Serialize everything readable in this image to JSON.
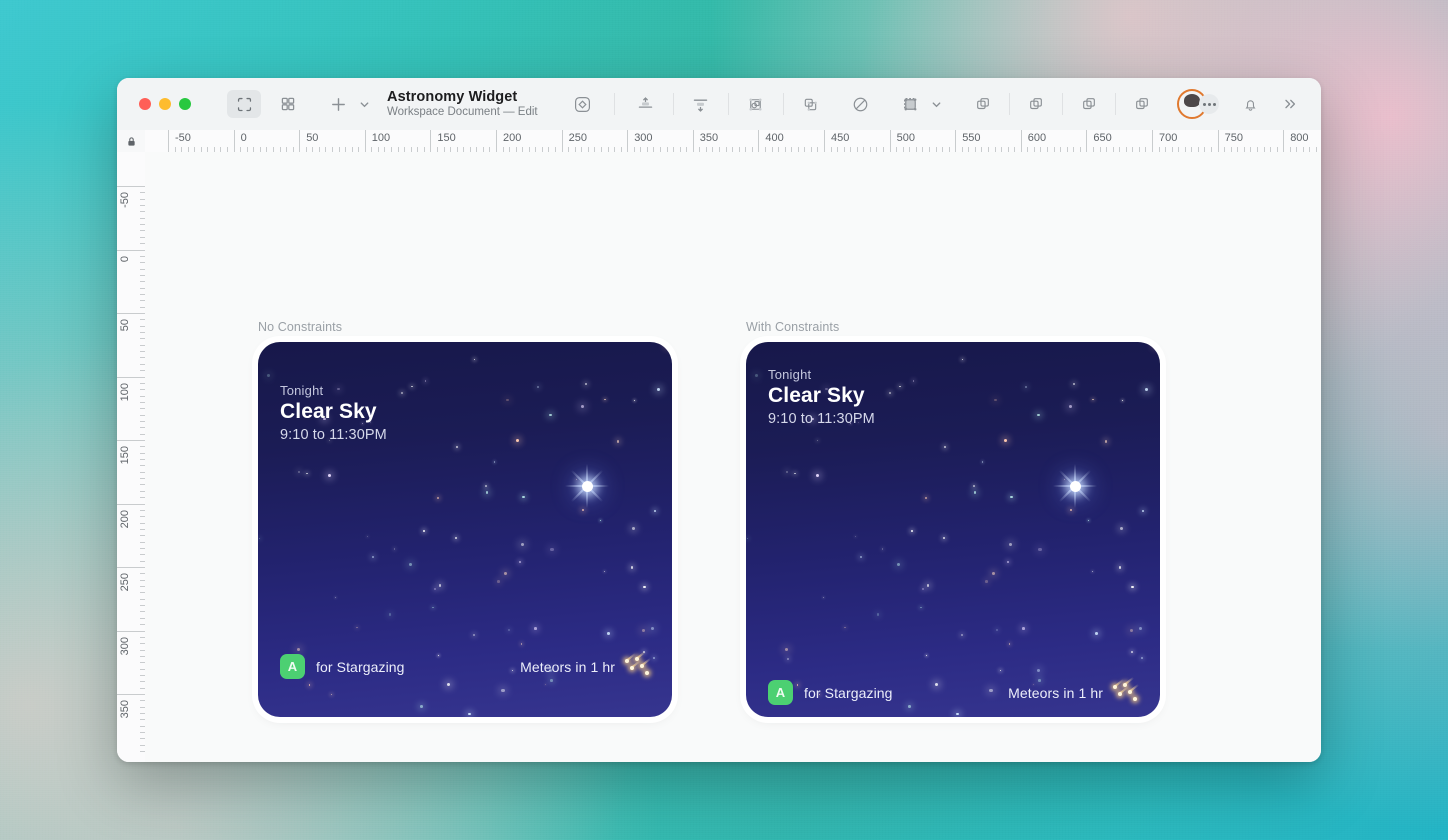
{
  "window": {
    "title": "Astronomy Widget",
    "subtitle": "Workspace Document — Edit",
    "traffic_lights": [
      "close",
      "minimize",
      "zoom"
    ]
  },
  "toolbar": {
    "left_tools": [
      {
        "name": "artboard-tool",
        "label": "Artboard",
        "active": true
      },
      {
        "name": "grid-tool",
        "label": "Grid View",
        "active": false
      },
      {
        "name": "insert-tool",
        "label": "Insert",
        "active": false
      },
      {
        "name": "insert-chevron",
        "label": "Insert menu",
        "active": false
      }
    ],
    "center_tools": [
      {
        "name": "shape-tool",
        "label": "Shape"
      },
      {
        "name": "align-top-tool",
        "label": "Align Top"
      },
      {
        "name": "distribute-tool",
        "label": "Distribute"
      },
      {
        "name": "mask-tool",
        "label": "Mask"
      },
      {
        "name": "boolean-tool",
        "label": "Boolean"
      },
      {
        "name": "style-tool",
        "label": "Style"
      },
      {
        "name": "constraints-tool",
        "label": "Constraints"
      },
      {
        "name": "constraints-chevron",
        "label": "Constraints menu"
      }
    ],
    "right_tools": [
      {
        "name": "union-tool",
        "label": "Union"
      },
      {
        "name": "subtract-tool",
        "label": "Subtract"
      },
      {
        "name": "intersect-tool",
        "label": "Intersect"
      },
      {
        "name": "difference-tool",
        "label": "Difference"
      }
    ],
    "account": {
      "name": "user-avatar",
      "label": "Account"
    },
    "more_label": "More",
    "notifications_label": "Notifications",
    "overflow_label": "More toolbar items"
  },
  "rulers": {
    "lock_icon": "lock-icon",
    "horizontal_ticks": [
      "-50",
      "0",
      "50",
      "100",
      "150",
      "200",
      "250",
      "300",
      "350",
      "400",
      "450",
      "500",
      "550",
      "600",
      "650",
      "700",
      "750",
      "800"
    ],
    "vertical_ticks": [
      "-50",
      "0",
      "50",
      "100",
      "150",
      "200",
      "250",
      "300",
      "350"
    ],
    "unit_step": 50
  },
  "canvas": {
    "artboards": [
      {
        "label": "No Constraints",
        "widget": {
          "eyebrow": "Tonight",
          "title": "Clear Sky",
          "time_range": "9:10 to 11:30PM",
          "badge_letter": "A",
          "footer_left": "for Stargazing",
          "footer_right": "Meteors in 1 hr",
          "footer_icon": "meteor-shower-icon"
        }
      },
      {
        "label": "With Constraints",
        "widget": {
          "eyebrow": "Tonight",
          "title": "Clear Sky",
          "time_range": "9:10 to 11:30PM",
          "badge_letter": "A",
          "footer_left": "for Stargazing",
          "footer_right": "Meteors in 1 hr",
          "footer_icon": "meteor-shower-icon"
        }
      }
    ]
  },
  "colors": {
    "widget_gradient_top": "#17184a",
    "widget_gradient_bottom": "#36358f",
    "badge_green": "#4cd072",
    "avatar_ring": "#e0792f",
    "traffic_red": "#ff5f57",
    "traffic_yellow": "#febc2e",
    "traffic_green": "#28c840",
    "label_grey": "#9aa0a6"
  }
}
